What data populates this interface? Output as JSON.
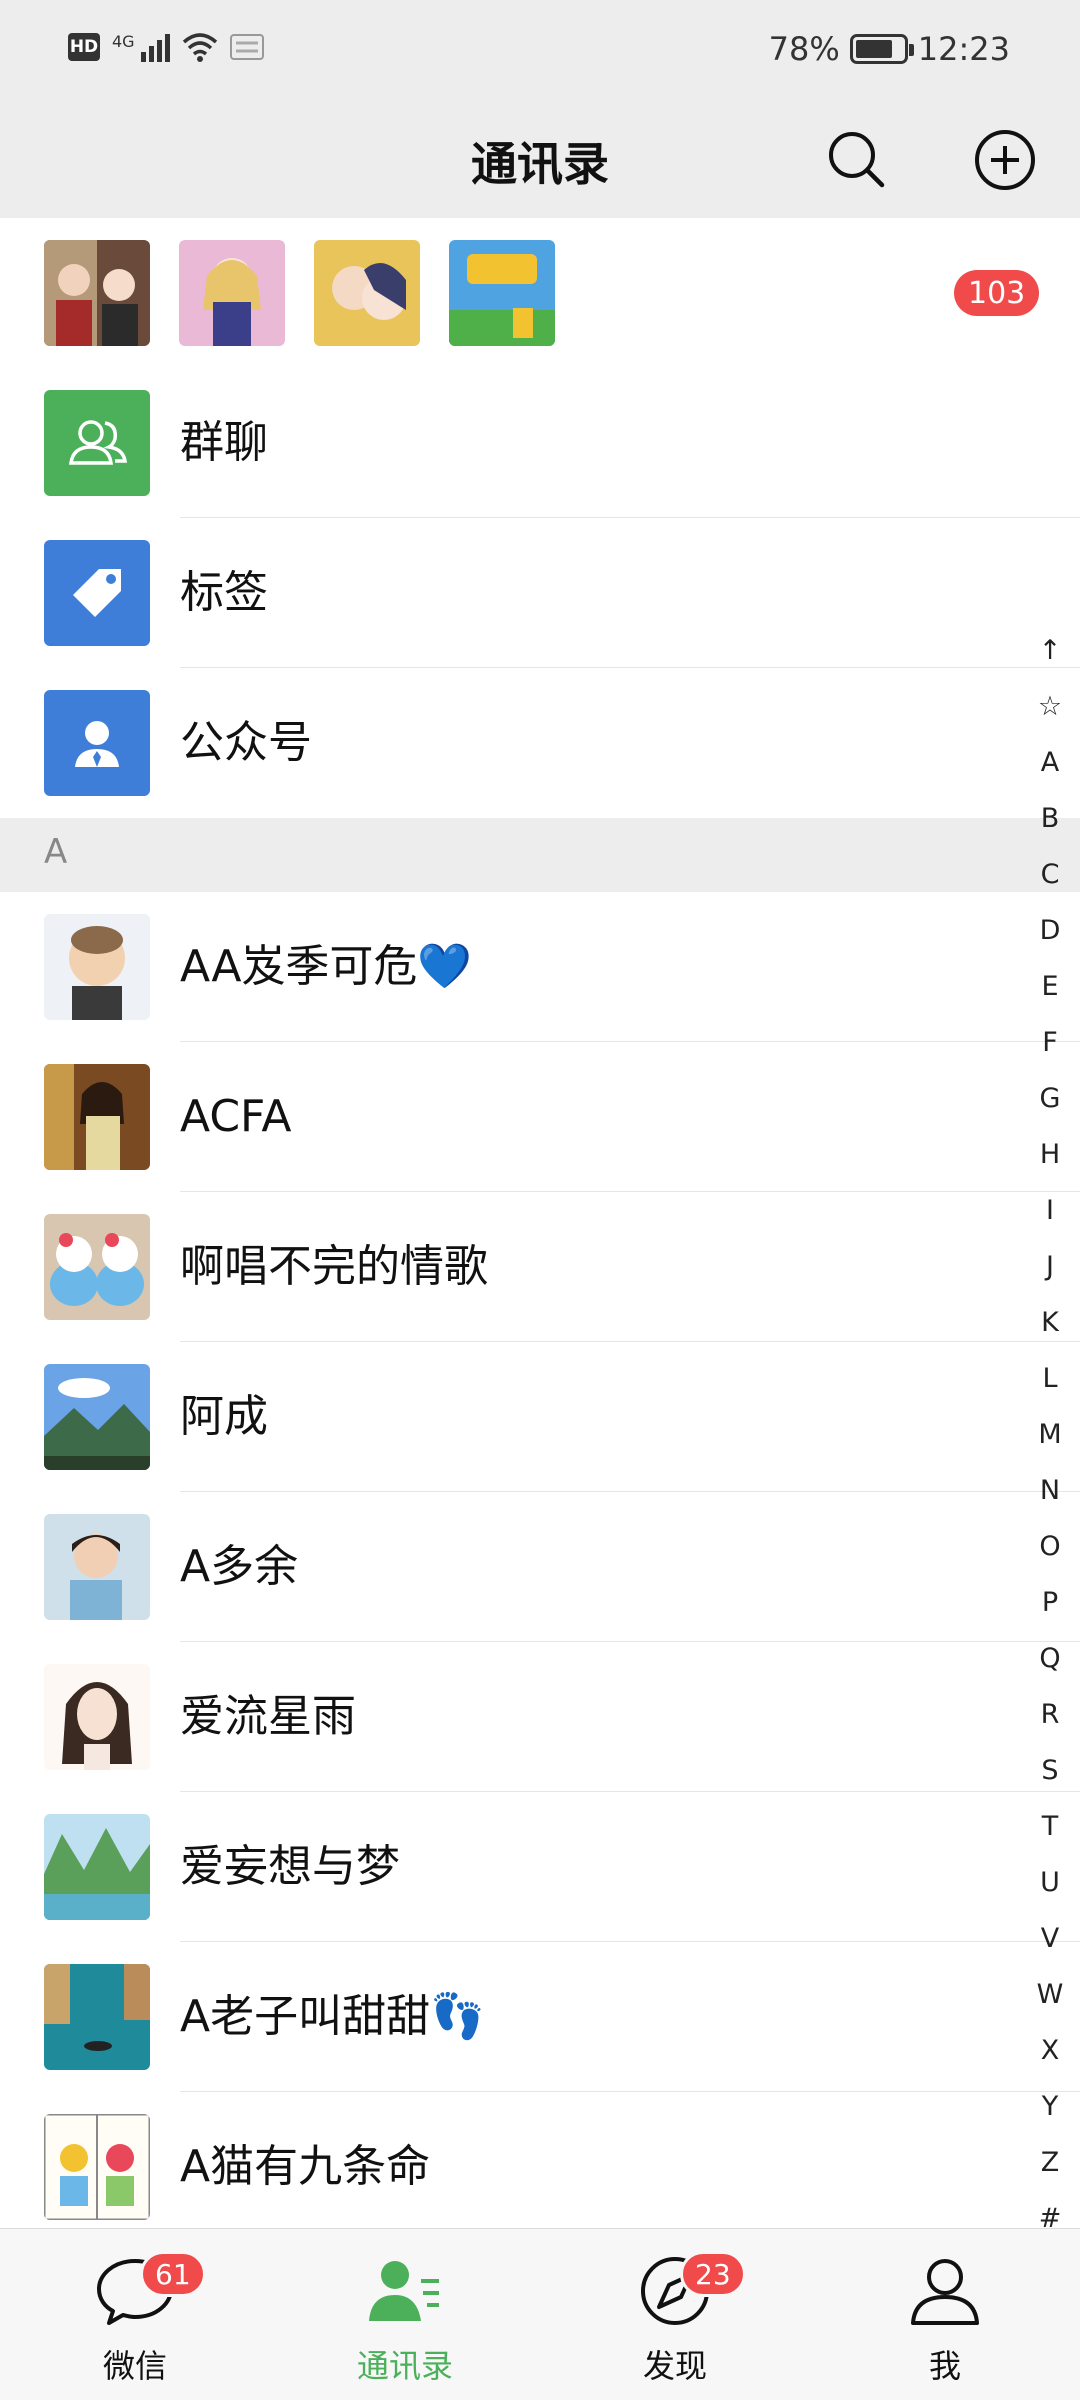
{
  "status_bar": {
    "hd": "HD",
    "network": "4G",
    "battery": "78%",
    "time": "12:23"
  },
  "header": {
    "title": "通讯录"
  },
  "new_friends": {
    "count": "103"
  },
  "functions": [
    {
      "label": "群聊",
      "icon": "group-chat-icon",
      "color": "#4cb05b"
    },
    {
      "label": "标签",
      "icon": "tag-icon",
      "color": "#3f7ed8"
    },
    {
      "label": "公众号",
      "icon": "official-account-icon",
      "color": "#3f7ed8"
    }
  ],
  "section": {
    "letter": "A"
  },
  "contacts": [
    {
      "name": "AA岌季可危💙"
    },
    {
      "name": "ACFA"
    },
    {
      "name": "啊唱不完的情歌"
    },
    {
      "name": "阿成"
    },
    {
      "name": "A多余"
    },
    {
      "name": "爱流星雨"
    },
    {
      "name": "爱妄想与梦"
    },
    {
      "name": "A老子叫甜甜👣"
    },
    {
      "name": "A猫有九条命"
    }
  ],
  "index": [
    "↑",
    "☆",
    "A",
    "B",
    "C",
    "D",
    "E",
    "F",
    "G",
    "H",
    "I",
    "J",
    "K",
    "L",
    "M",
    "N",
    "O",
    "P",
    "Q",
    "R",
    "S",
    "T",
    "U",
    "V",
    "W",
    "X",
    "Y",
    "Z",
    "#"
  ],
  "tabs": [
    {
      "label": "微信",
      "badge": "61"
    },
    {
      "label": "通讯录",
      "badge": ""
    },
    {
      "label": "发现",
      "badge": "23"
    },
    {
      "label": "我",
      "badge": ""
    }
  ],
  "colors": {
    "accent_green": "#4cb05b",
    "badge_red": "#f04a4a",
    "tile_blue": "#3f7ed8"
  }
}
